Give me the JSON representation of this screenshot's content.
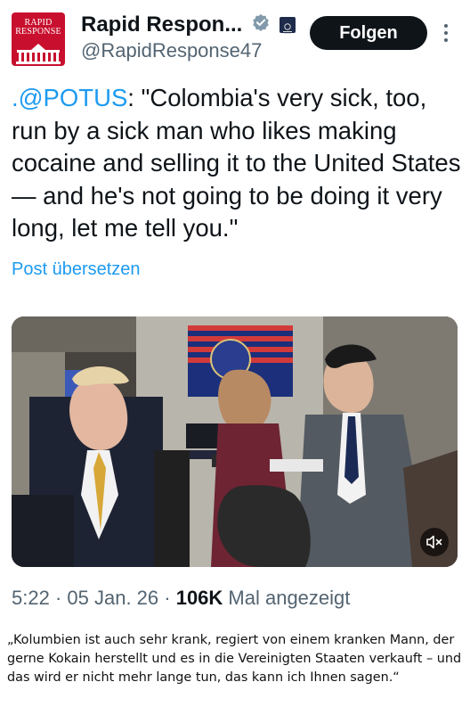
{
  "account": {
    "avatar_logo_text": "RAPID RESPONSE",
    "display_name": "Rapid Respon...",
    "handle": "@RapidResponse47",
    "verified_icon": "verified-badge-icon",
    "government_icon": "government-seal-icon"
  },
  "follow_button": {
    "label": "Folgen"
  },
  "more_button": {
    "icon": "more-vertical-icon"
  },
  "tweet": {
    "mention": ".@POTUS",
    "body": ": \"Colombia's very sick, too, run by a sick man who likes making cocaine and selling it to the United States — and he's not going to be doing it very long, let me tell you.\""
  },
  "translate_link": {
    "label": "Post übersetzen"
  },
  "media": {
    "type": "video",
    "mute_icon": "speaker-muted-icon"
  },
  "meta": {
    "time": "5:22",
    "separator": " · ",
    "date": "05 Jan. 26",
    "views_count": "106K",
    "views_label": " Mal angezeigt"
  },
  "caption": {
    "text": "„Kolumbien ist auch sehr krank, regiert von einem kranken Mann, der gerne Kokain herstellt und es in die Vereinigten Staaten verkauft – und das wird er nicht mehr lange tun, das kann ich Ihnen sagen.“"
  },
  "colors": {
    "link": "#1d9bf0",
    "secondary_text": "#536471",
    "primary_text": "#0f1419",
    "avatar_red": "#c8102e"
  }
}
